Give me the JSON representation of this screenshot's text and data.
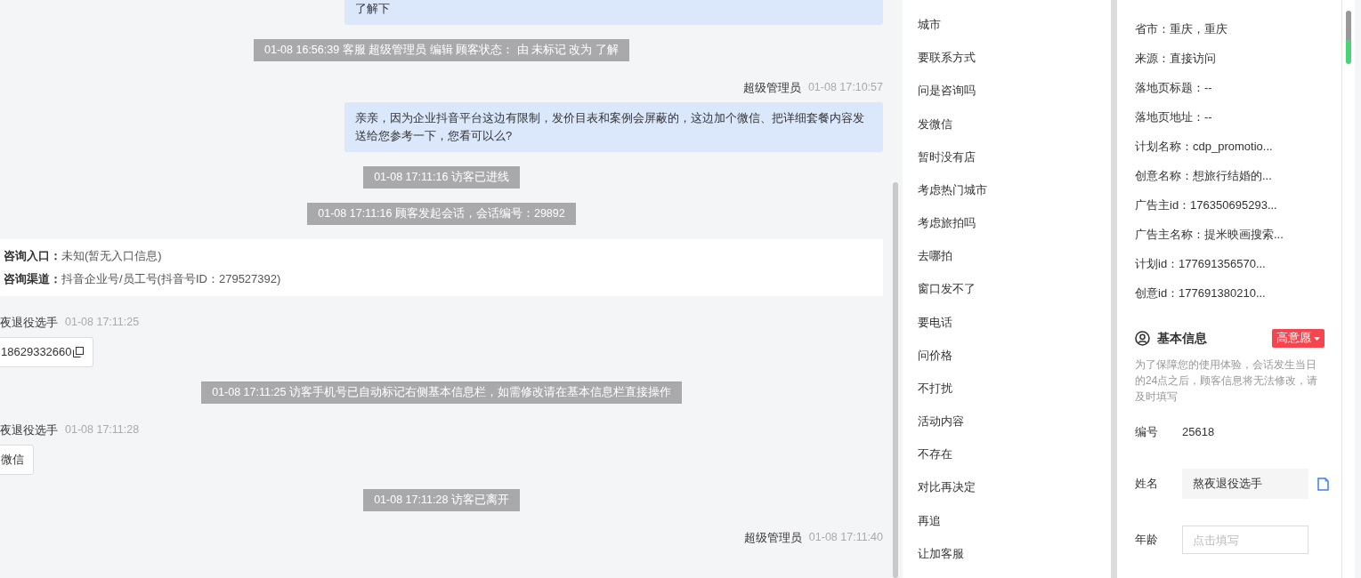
{
  "chat": {
    "messages": [
      {
        "kind": "bubble",
        "outgoing": true,
        "text": "了解下"
      },
      {
        "kind": "system",
        "text": "01-08 16:56:39 客服 超级管理员 编辑 顾客状态： 由 未标记 改为 了解"
      },
      {
        "kind": "meta",
        "outgoing": true,
        "sender": "超级管理员",
        "time": "01-08 17:10:57"
      },
      {
        "kind": "bubble",
        "outgoing": true,
        "text": "亲亲，因为企业抖音平台这边有限制，发价目表和案例会屏蔽的，这边加个微信、把详细套餐内容发送给您参考一下，您看可以么?"
      },
      {
        "kind": "system",
        "text": "01-08 17:11:16 访客已进线"
      },
      {
        "kind": "system",
        "text": "01-08 17:11:16 顾客发起会话，会话编号：29892"
      },
      {
        "kind": "info",
        "rows": [
          {
            "label": "咨询入口：",
            "value": "未知(暂无入口信息)"
          },
          {
            "label": "咨询渠道：",
            "value": "抖音企业号/员工号(抖音号ID：279527392)"
          }
        ]
      },
      {
        "kind": "meta",
        "outgoing": false,
        "sender": "夜退役选手",
        "time": "01-08 17:11:25"
      },
      {
        "kind": "bubble",
        "outgoing": false,
        "text": "18629332660",
        "copy": true
      },
      {
        "kind": "system",
        "text": "01-08 17:11:25 访客手机号已自动标记右侧基本信息栏，如需修改请在基本信息栏直接操作"
      },
      {
        "kind": "meta",
        "outgoing": false,
        "sender": "夜退役选手",
        "time": "01-08 17:11:28"
      },
      {
        "kind": "bubble",
        "outgoing": false,
        "text": "微信"
      },
      {
        "kind": "system",
        "text": "01-08 17:11:28 访客已离开"
      },
      {
        "kind": "meta",
        "outgoing": true,
        "sender": "超级管理员",
        "time": "01-08 17:11:40"
      }
    ]
  },
  "quick_replies": [
    "城市",
    "要联系方式",
    "问是咨询吗",
    "发微信",
    "暂时没有店",
    "考虑热门城市",
    "考虑旅拍吗",
    "去哪拍",
    "窗口发不了",
    "要电话",
    "问价格",
    "不打扰",
    "活动内容",
    "不存在",
    "对比再决定",
    "再追",
    "让加客服"
  ],
  "visitor_info": [
    "省市：重庆，重庆",
    "来源：直接访问",
    "落地页标题：--",
    "落地页地址：--",
    "计划名称：cdp_promotio...",
    "创意名称：想旅行结婚的...",
    "广告主id：176350695293...",
    "广告主名称：提米映画搜索...",
    "计划id：177691356570...",
    "创意id：177691380210..."
  ],
  "basic_info": {
    "title": "基本信息",
    "intent_tag": "高意愿",
    "note": "为了保障您的使用体验，会话发生当日的24点之后，顾客信息将无法修改，请及时填写",
    "fields": [
      {
        "kind": "text",
        "label": "编号",
        "value": "25618"
      },
      {
        "kind": "filled",
        "label": "姓名",
        "value": "熬夜退役选手",
        "copy": true
      },
      {
        "kind": "input",
        "label": "年龄",
        "placeholder": "点击填写"
      }
    ]
  }
}
